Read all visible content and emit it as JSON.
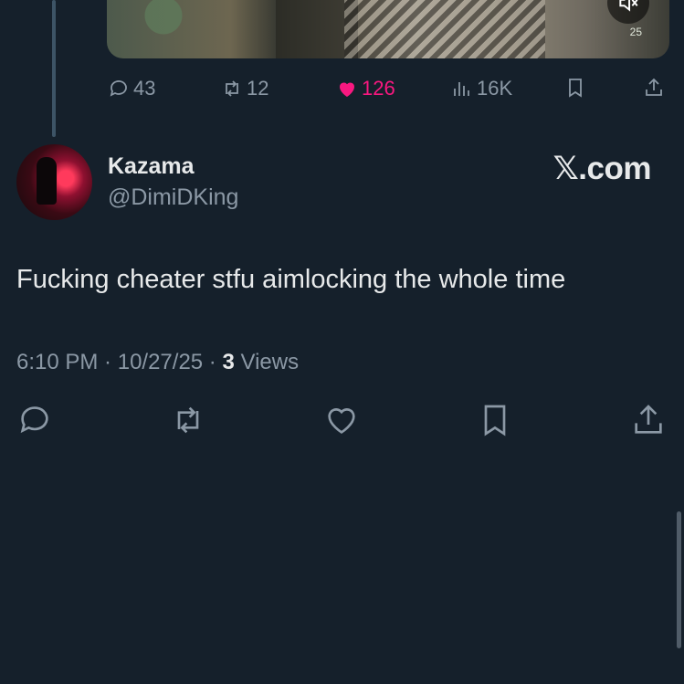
{
  "parent_tweet": {
    "video": {
      "mute_icon": "muted-speaker-icon",
      "hud_counter": "25"
    },
    "stats": {
      "replies": "43",
      "reposts": "12",
      "likes": "126",
      "views": "16K"
    }
  },
  "tweet": {
    "display_name": "Kazama",
    "handle": "@DimiDKing",
    "brand": "𝕏.com",
    "text": "Fucking cheater stfu aimlocking the whole time",
    "time": "6:10 PM",
    "separator": " · ",
    "date": "10/27/25",
    "view_count": "3",
    "views_label": " Views"
  },
  "colors": {
    "background": "#15202b",
    "primary_text": "#e7e9ea",
    "secondary_text": "#8b98a5",
    "like_pink": "#f91880"
  }
}
